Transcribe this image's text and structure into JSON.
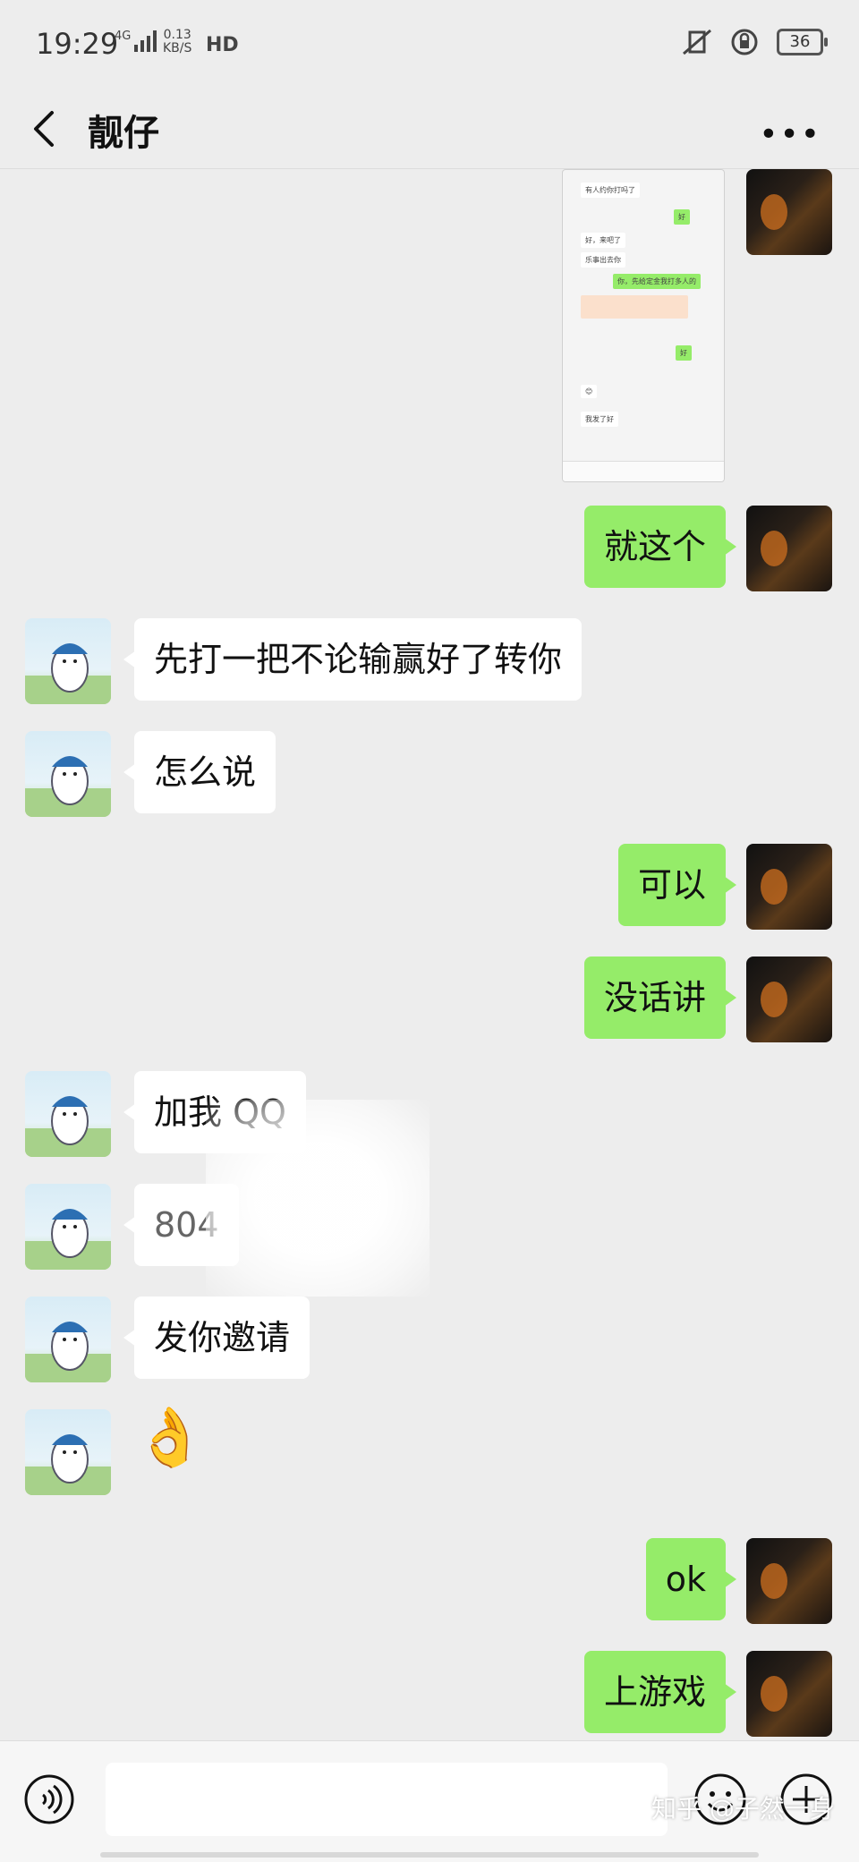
{
  "status": {
    "time": "19:29",
    "network": "4G",
    "speed_top": "0.13",
    "speed_bottom": "KB/S",
    "hd": "HD",
    "battery": "36"
  },
  "header": {
    "title": "靓仔"
  },
  "shared_screenshot": {
    "lines": [
      "有人约你打吗了",
      "好，来吧了",
      "乐事出去你",
      "你，先给定金我打多人的",
      "我发了好"
    ]
  },
  "messages": [
    {
      "side": "me",
      "text": "就这个"
    },
    {
      "side": "them",
      "text": "先打一把不论输赢好了转你"
    },
    {
      "side": "them",
      "text": "怎么说"
    },
    {
      "side": "me",
      "text": "可以"
    },
    {
      "side": "me",
      "text": "没话讲"
    },
    {
      "side": "them",
      "text": "加我 QQ"
    },
    {
      "side": "them",
      "text": "804"
    },
    {
      "side": "them",
      "text": "发你邀请"
    },
    {
      "side": "them",
      "text": "👌"
    },
    {
      "side": "me",
      "text": "ok"
    },
    {
      "side": "me",
      "text": "上游戏"
    }
  ],
  "input": {
    "placeholder": ""
  },
  "watermark": "知乎 @子然一身",
  "colors": {
    "background": "#ededed",
    "my_bubble": "#95ec69",
    "their_bubble": "#ffffff"
  }
}
